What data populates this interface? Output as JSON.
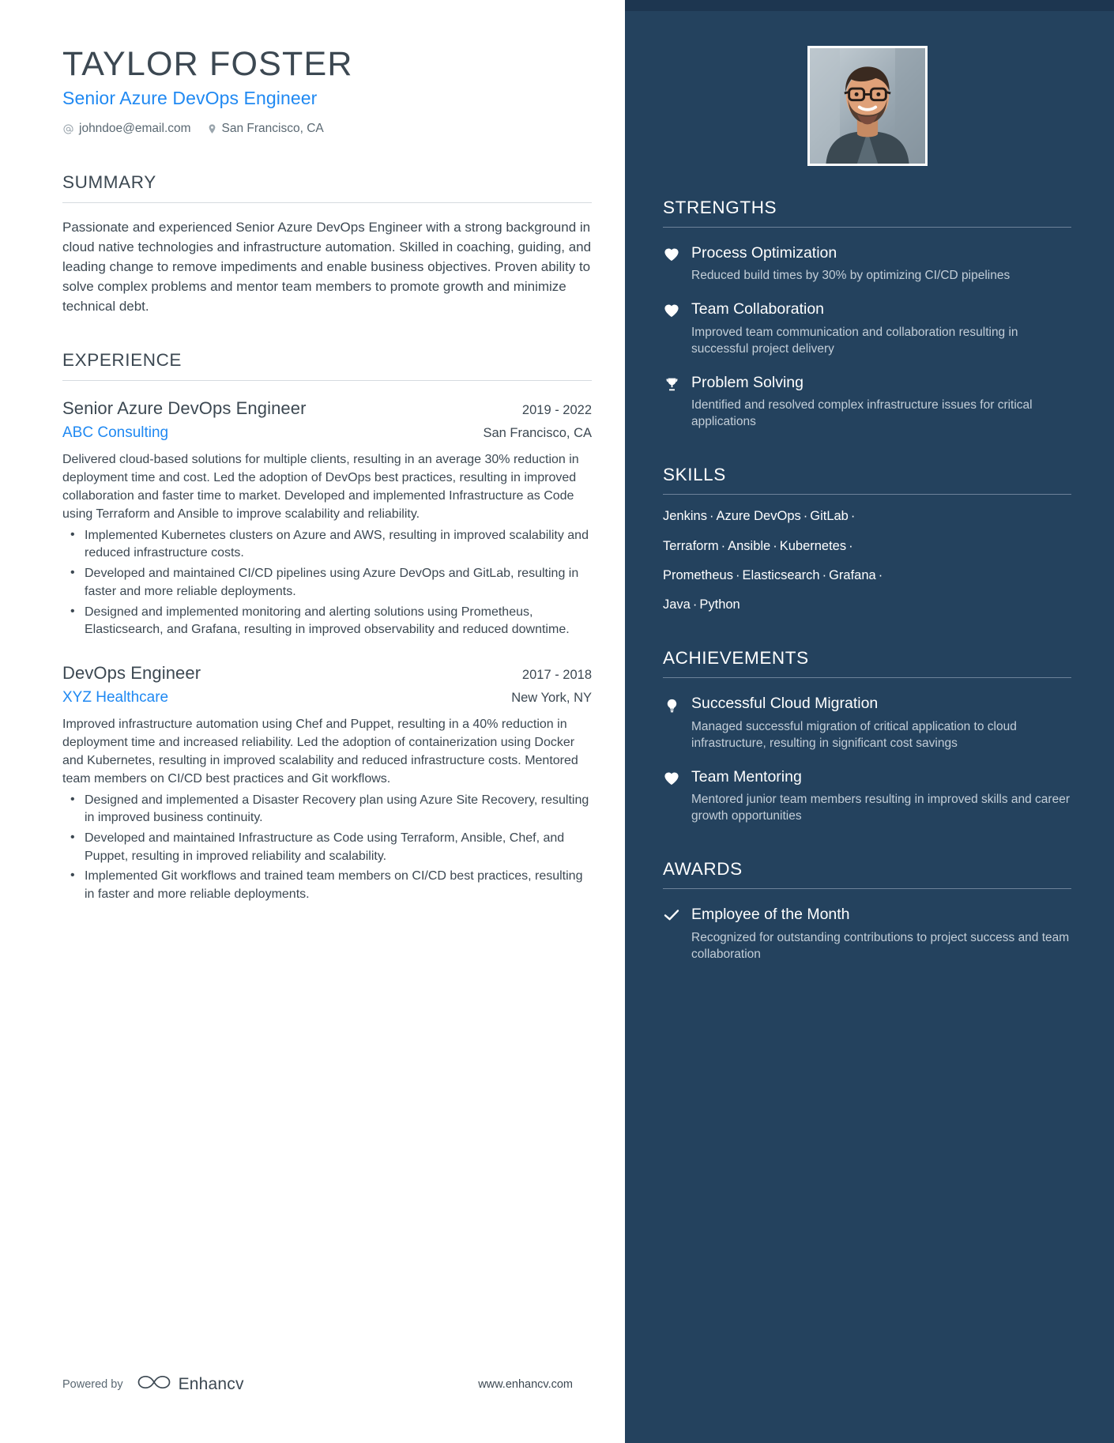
{
  "header": {
    "name": "TAYLOR FOSTER",
    "role": "Senior Azure DevOps Engineer",
    "email": "johndoe@email.com",
    "location": "San Francisco, CA",
    "email_icon": "at-sign-icon",
    "location_icon": "map-pin-icon"
  },
  "summary": {
    "title": "SUMMARY",
    "body": "Passionate and experienced Senior Azure DevOps Engineer with a strong background in cloud native technologies and infrastructure automation. Skilled in coaching, guiding, and leading change to remove impediments and enable business objectives. Proven ability to solve complex problems and mentor team members to promote growth and minimize technical debt."
  },
  "experience": {
    "title": "EXPERIENCE",
    "jobs": [
      {
        "title": "Senior Azure DevOps Engineer",
        "date": "2019 - 2022",
        "company": "ABC Consulting",
        "location": "San Francisco, CA",
        "description": "Delivered cloud-based solutions for multiple clients, resulting in an average 30% reduction in deployment time and cost. Led the adoption of DevOps best practices, resulting in improved collaboration and faster time to market. Developed and implemented Infrastructure as Code using Terraform and Ansible to improve scalability and reliability.",
        "bullets": [
          "Implemented Kubernetes clusters on Azure and AWS, resulting in improved scalability and reduced infrastructure costs.",
          "Developed and maintained CI/CD pipelines using Azure DevOps and GitLab, resulting in faster and more reliable deployments.",
          "Designed and implemented monitoring and alerting solutions using Prometheus, Elasticsearch, and Grafana, resulting in improved observability and reduced downtime."
        ]
      },
      {
        "title": "DevOps Engineer",
        "date": "2017 - 2018",
        "company": "XYZ Healthcare",
        "location": "New York, NY",
        "description": "Improved infrastructure automation using Chef and Puppet, resulting in a 40% reduction in deployment time and increased reliability. Led the adoption of containerization using Docker and Kubernetes, resulting in improved scalability and reduced infrastructure costs. Mentored team members on CI/CD best practices and Git workflows.",
        "bullets": [
          "Designed and implemented a Disaster Recovery plan using Azure Site Recovery, resulting in improved business continuity.",
          "Developed and maintained Infrastructure as Code using Terraform, Ansible, Chef, and Puppet, resulting in improved reliability and scalability.",
          "Implemented Git workflows and trained team members on CI/CD best practices, resulting in faster and more reliable deployments."
        ]
      }
    ]
  },
  "footer": {
    "powered_by": "Powered by",
    "brand": "Enhancv",
    "brand_icon": "infinity-logo-icon",
    "website": "www.enhancv.com"
  },
  "sidebar": {
    "photo_alt": "profile-photo",
    "strengths": {
      "title": "STRENGTHS",
      "items": [
        {
          "icon": "heart-icon",
          "title": "Process Optimization",
          "desc": "Reduced build times by 30% by optimizing CI/CD pipelines"
        },
        {
          "icon": "heart-icon",
          "title": "Team Collaboration",
          "desc": "Improved team communication and collaboration resulting in successful project delivery"
        },
        {
          "icon": "trophy-icon",
          "title": "Problem Solving",
          "desc": "Identified and resolved complex infrastructure issues for critical applications"
        }
      ]
    },
    "skills": {
      "title": "SKILLS",
      "lines": [
        [
          "Jenkins",
          "Azure DevOps",
          "GitLab"
        ],
        [
          "Terraform",
          "Ansible",
          "Kubernetes"
        ],
        [
          "Prometheus",
          "Elasticsearch",
          "Grafana"
        ],
        [
          "Java",
          "Python"
        ]
      ]
    },
    "achievements": {
      "title": "ACHIEVEMENTS",
      "items": [
        {
          "icon": "lightbulb-icon",
          "title": "Successful Cloud Migration",
          "desc": "Managed successful migration of critical application to cloud infrastructure, resulting in significant cost savings"
        },
        {
          "icon": "heart-icon",
          "title": "Team Mentoring",
          "desc": "Mentored junior team members resulting in improved skills and career growth opportunities"
        }
      ]
    },
    "awards": {
      "title": "AWARDS",
      "items": [
        {
          "icon": "check-icon",
          "title": "Employee of the Month",
          "desc": "Recognized for outstanding contributions to project success and team collaboration"
        }
      ]
    }
  },
  "colors": {
    "accent_blue": "#2089f2",
    "sidebar_bg": "#24425e",
    "sidebar_top": "#1d3650",
    "text_dark": "#3c4852",
    "muted": "#c3ced8"
  }
}
